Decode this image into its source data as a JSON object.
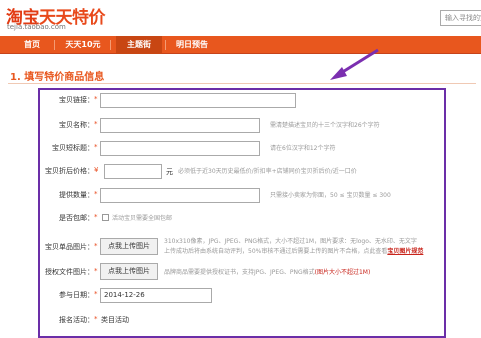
{
  "header": {
    "logo_text_a": "淘宝",
    "logo_text_b": "天天特价",
    "logo_domain": "tejia.taobao.com",
    "search_placeholder": "输入寻找的宝贝"
  },
  "nav": {
    "items": [
      {
        "label": "首页"
      },
      {
        "label": "天天10元"
      },
      {
        "label": "主题街"
      },
      {
        "label": "明日预告"
      }
    ]
  },
  "section": {
    "title": "1. 填写特价商品信息"
  },
  "form": {
    "link": {
      "label": "宝贝链接：",
      "req": "*",
      "value": ""
    },
    "name": {
      "label": "宝贝名称：",
      "req": "*",
      "value": "",
      "hint": "需清楚描述宝贝的十三个汉字和26个字符"
    },
    "short": {
      "label": "宝贝短标题：",
      "req": "*",
      "value": "",
      "hint": "请在6位汉字和12个字符"
    },
    "price": {
      "label": "宝贝折后价格：",
      "req": "¥",
      "value": "",
      "unit": "元",
      "hint": "必须低于近30天历史最低价/折扣率+店铺同价宝贝折后价/近一口价"
    },
    "quantity": {
      "label": "提供数量：",
      "req": "*",
      "value": "",
      "hint": "只需接小卖家为你面，50 ≤ 宝贝数量 ≤ 300"
    },
    "shipping": {
      "label": "是否包邮：",
      "req": "*",
      "option": "活动宝贝需要全国包邮"
    },
    "image": {
      "label": "宝贝单品图片：",
      "req": "*",
      "button": "点我上传图片",
      "hint1": "310x310像素，JPG、JPEG、PNG格式，大小不超过1M，图片要求：无logo、无水印、无文字",
      "hint2": "上传成功后将由系统自动评判，50%审核不通过后需要上传的图片不合格，点此查看",
      "link": "宝贝图片规范"
    },
    "license": {
      "label": "授权文件图片：",
      "req": "*",
      "button": "点我上传图片",
      "hint": "品牌商品需要提供授权证书，支持JPG、JPEG、PNG格式",
      "hint_red": "(图片大小不超过1M)"
    },
    "date": {
      "label": "参与日期：",
      "req": "*",
      "value": "2014-12-26"
    },
    "activity": {
      "label": "报名活动：",
      "req": "*",
      "value": "类目活动"
    }
  }
}
